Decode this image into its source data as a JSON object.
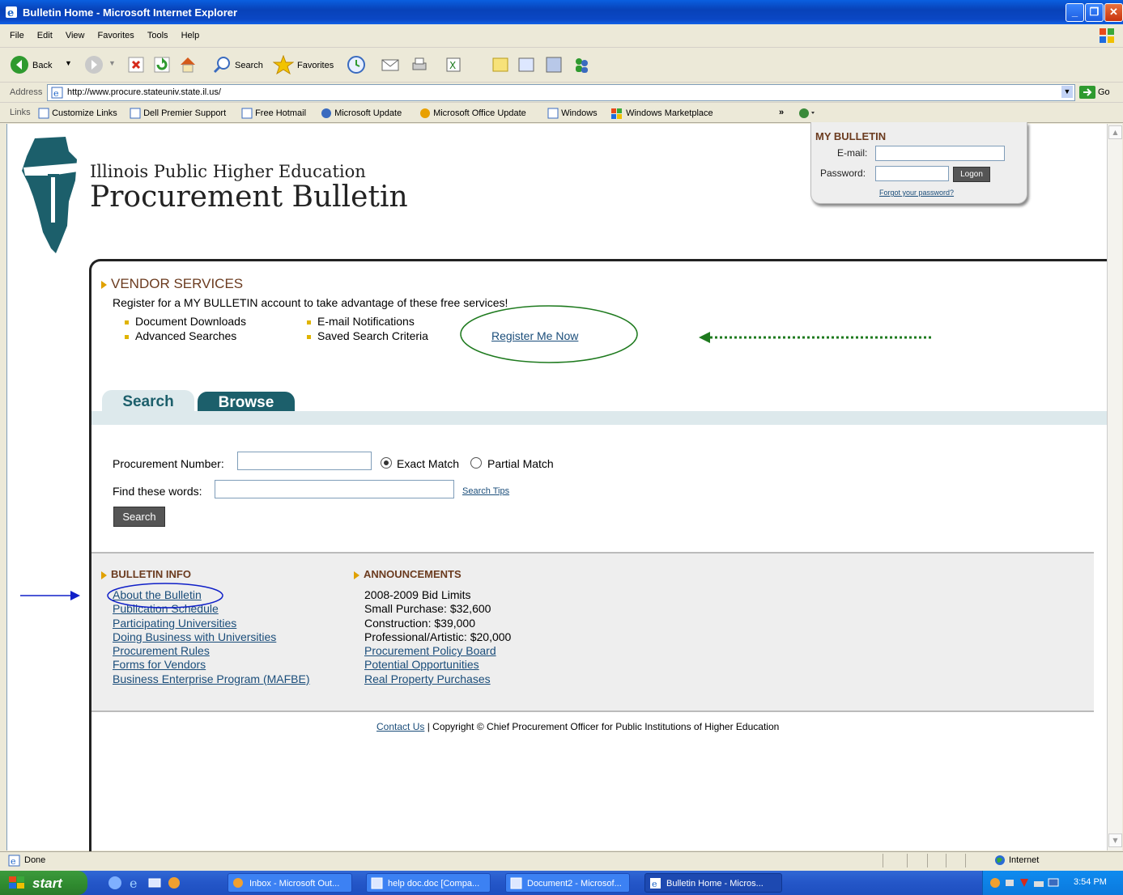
{
  "window": {
    "title": "Bulletin Home - Microsoft Internet Explorer"
  },
  "menu": [
    "File",
    "Edit",
    "View",
    "Favorites",
    "Tools",
    "Help"
  ],
  "toolbar": {
    "back_label": "Back",
    "search_label": "Search",
    "favorites_label": "Favorites"
  },
  "address": {
    "label": "Address",
    "url": "http://www.procure.stateuniv.state.il.us/",
    "go_label": "Go"
  },
  "links": {
    "label": "Links",
    "items": [
      "Customize Links",
      "Dell Premier Support",
      "Free Hotmail",
      "Microsoft Update",
      "Microsoft Office Update",
      "Windows",
      "Windows Marketplace"
    ]
  },
  "site": {
    "subtitle": "Illinois Public Higher Education",
    "title": "Procurement Bulletin"
  },
  "my_bulletin": {
    "heading": "MY BULLETIN",
    "email_label": "E-mail:",
    "password_label": "Password:",
    "logon_label": "Logon",
    "forgot_label": "Forgot your password?"
  },
  "vendor": {
    "heading": "VENDOR SERVICES",
    "intro": "Register for a MY BULLETIN account to take advantage of these free services!",
    "features_left": [
      "Document Downloads",
      "Advanced Searches"
    ],
    "features_right": [
      "E-mail Notifications",
      "Saved Search Criteria"
    ],
    "register_label": "Register Me Now"
  },
  "tabs": {
    "search": "Search",
    "browse": "Browse"
  },
  "search_form": {
    "procurement_label": "Procurement Number:",
    "exact_label": "Exact Match",
    "partial_label": "Partial Match",
    "words_label": "Find these words:",
    "tips_label": "Search Tips",
    "button_label": "Search"
  },
  "bulletin_info": {
    "heading": "BULLETIN INFO",
    "links": [
      "About the Bulletin",
      "Publication Schedule",
      "Participating Universities",
      "Doing Business with Universities",
      "Procurement Rules",
      "Forms for Vendors",
      "Business Enterprise Program (MAFBE)"
    ]
  },
  "announcements": {
    "heading": "ANNOUNCEMENTS",
    "lines": [
      "2008-2009 Bid Limits",
      "Small Purchase: $32,600",
      "Construction: $39,000",
      "Professional/Artistic: $20,000"
    ],
    "links": [
      "Procurement Policy Board",
      "Potential Opportunities",
      "Real Property Purchases"
    ]
  },
  "footer": {
    "contact_label": "Contact Us",
    "copyright": "| Copyright © Chief Procurement Officer for Public Institutions of Higher Education"
  },
  "status": {
    "text": "Done",
    "zone": "Internet"
  },
  "taskbar": {
    "start_label": "start",
    "tasks": [
      "Inbox - Microsoft Out...",
      "help doc.doc [Compa...",
      "Document2 - Microsof...",
      "Bulletin Home - Micros..."
    ],
    "clock": "3:54 PM"
  },
  "colors": {
    "teal": "#1c5f6b",
    "brown": "#6b3b1f",
    "annotation_green": "#1e7a1e",
    "annotation_blue": "#1020c8"
  }
}
